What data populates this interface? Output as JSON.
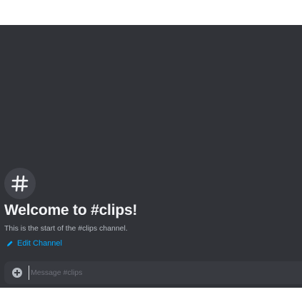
{
  "channel": {
    "welcome_title": "Welcome to #clips!",
    "welcome_subtitle": "This is the start of the #clips channel.",
    "edit_label": "Edit Channel"
  },
  "composer": {
    "placeholder": "Message #clips",
    "value": ""
  },
  "icons": {
    "channel": "hash-icon",
    "edit": "pencil-icon",
    "attach": "plus-circle-icon"
  },
  "colors": {
    "background": "#313338",
    "link": "#00a8fc",
    "title": "#f2f3f5",
    "subtitle": "#b5bac1",
    "composer": "#383a40"
  }
}
